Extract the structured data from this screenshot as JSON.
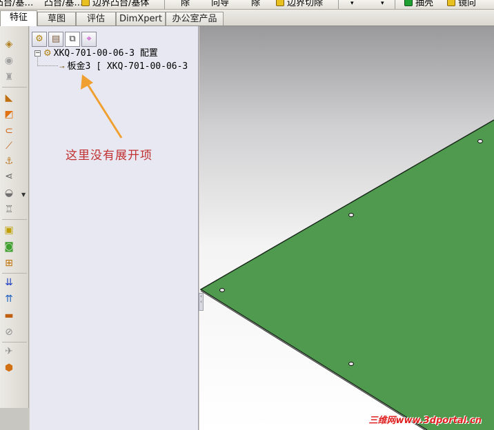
{
  "top_toolbar": {
    "items": [
      {
        "label": "凸台/基…",
        "icon": ""
      },
      {
        "label": "凸台/基…",
        "icon": ""
      },
      {
        "label": "边界凸台/基体",
        "icon": "boundary-boss-icon"
      },
      {
        "label": "除",
        "icon": ""
      },
      {
        "label": "向导",
        "icon": ""
      },
      {
        "label": "除",
        "icon": ""
      },
      {
        "label": "边界切除",
        "icon": "boundary-cut-icon"
      },
      {
        "label": "抽壳",
        "icon": "shell-icon"
      },
      {
        "label": "镜向",
        "icon": "mirror-icon"
      }
    ]
  },
  "command_tabs": [
    {
      "label": "特征",
      "active": true
    },
    {
      "label": "草图",
      "active": false
    },
    {
      "label": "评估",
      "active": false
    },
    {
      "label": "DimXpert",
      "active": false
    },
    {
      "label": "办公室产品",
      "active": false
    }
  ],
  "feature_manager": {
    "panel_tabs": [
      {
        "icon": "feature-manager-icon",
        "glyph": "⚙"
      },
      {
        "icon": "property-manager-icon",
        "glyph": "▤"
      },
      {
        "icon": "configuration-manager-icon",
        "glyph": "⧉"
      },
      {
        "icon": "dimxpert-manager-icon",
        "glyph": "⌖"
      }
    ],
    "tree": {
      "root_label": "XKQ-701-00-06-3 配置",
      "expander": "−",
      "child_label": "板金3 [ XKQ-701-00-06-3"
    }
  },
  "annotation": {
    "text": "这里没有展开项",
    "color": "#c03030",
    "arrow_color": "#f0a030"
  },
  "viewport": {
    "sheet_color": "#4f9a4f",
    "edge_color": "#1a2a1a"
  },
  "watermark": {
    "brand": "三维网",
    "url": "www.3dportal.cn"
  },
  "colors": {
    "panel_bg": "#e8e8f2",
    "toolbar_bg": "#d9d7d0"
  }
}
